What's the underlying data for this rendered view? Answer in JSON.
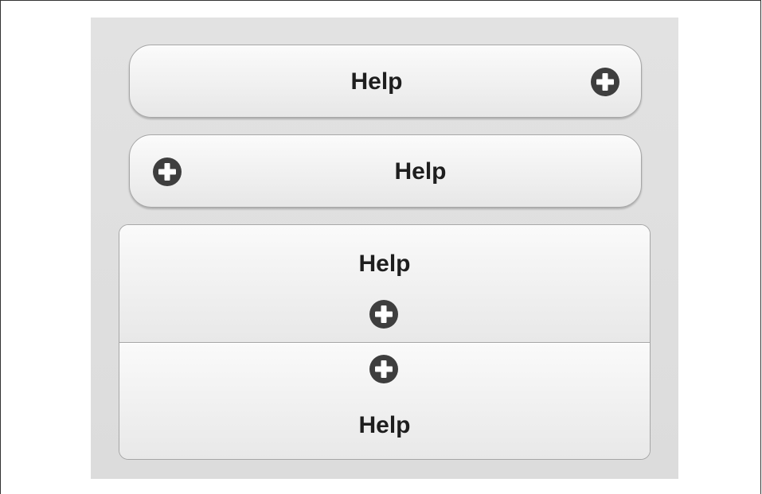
{
  "buttons": [
    {
      "label": "Help",
      "icon": "plus-circle-icon",
      "icon_position": "right"
    },
    {
      "label": "Help",
      "icon": "plus-circle-icon",
      "icon_position": "left"
    }
  ],
  "grouped": [
    {
      "label": "Help",
      "icon": "plus-circle-icon",
      "icon_position": "bottom"
    },
    {
      "label": "Help",
      "icon": "plus-circle-icon",
      "icon_position": "top"
    }
  ],
  "colors": {
    "background": "#dcdcdc",
    "button_text": "#1e1e1e",
    "icon": "#3e3e3e"
  }
}
